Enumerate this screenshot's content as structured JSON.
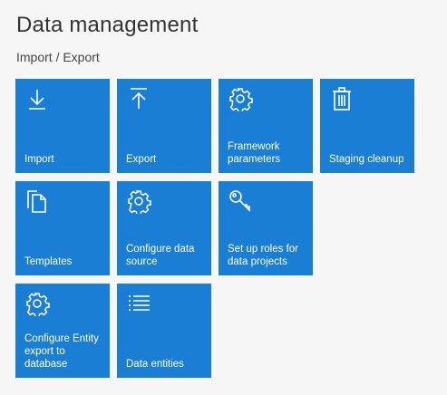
{
  "page": {
    "title": "Data management",
    "subtitle": "Import / Export"
  },
  "tiles": [
    {
      "label": "Import",
      "icon": "download-icon"
    },
    {
      "label": "Export",
      "icon": "upload-icon"
    },
    {
      "label": "Framework parameters",
      "icon": "gear-icon"
    },
    {
      "label": "Staging cleanup",
      "icon": "trash-icon"
    },
    {
      "label": "Templates",
      "icon": "documents-icon"
    },
    {
      "label": "Configure data source",
      "icon": "gear-icon"
    },
    {
      "label": "Set up roles for data projects",
      "icon": "key-icon"
    },
    {
      "label": "Configure Entity export to database",
      "icon": "gear-icon"
    },
    {
      "label": "Data entities",
      "icon": "list-icon"
    }
  ],
  "colors": {
    "tile": "#1a7fd4",
    "background": "#f6f6f6"
  }
}
